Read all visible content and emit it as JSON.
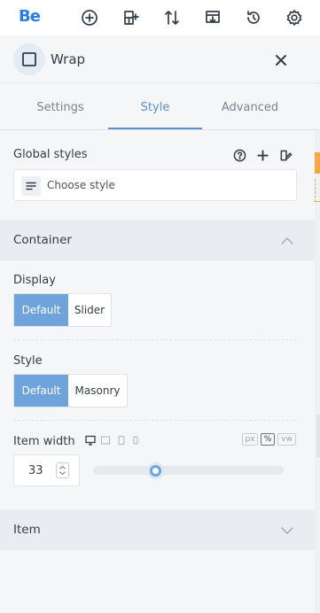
{
  "topbar": {
    "logo": "Be",
    "icons": [
      "add-circle-icon",
      "add-layout-icon",
      "sort-icon",
      "import-icon",
      "history-icon",
      "settings-icon"
    ]
  },
  "panel": {
    "element_title": "Wrap",
    "element_icon": "square-icon",
    "close_icon": "close-icon"
  },
  "tabs": [
    {
      "label": "Settings",
      "active": false
    },
    {
      "label": "Style",
      "active": true
    },
    {
      "label": "Advanced",
      "active": false
    }
  ],
  "global_styles": {
    "label": "Global styles",
    "select_placeholder": "Choose style",
    "icons": [
      "help-icon",
      "plus-icon",
      "style-edit-icon"
    ]
  },
  "container_section": {
    "title": "Container",
    "expanded": true,
    "display": {
      "label": "Display",
      "options": [
        "Default",
        "Slider"
      ],
      "selected": "Default"
    },
    "style": {
      "label": "Style",
      "options": [
        "Default",
        "Masonry"
      ],
      "selected": "Default"
    },
    "item_width": {
      "label": "Item width",
      "devices": [
        "desktop-icon",
        "laptop-icon",
        "tablet-icon",
        "mobile-icon"
      ],
      "units": [
        "px",
        "%",
        "vw"
      ],
      "selected_unit": "%",
      "value": "33",
      "slider_percent": 33
    }
  },
  "item_section": {
    "title": "Item",
    "expanded": false
  },
  "colors": {
    "accent": "#6fa3dc",
    "brand": "#2a7de1",
    "highlight": "#f2a844"
  }
}
